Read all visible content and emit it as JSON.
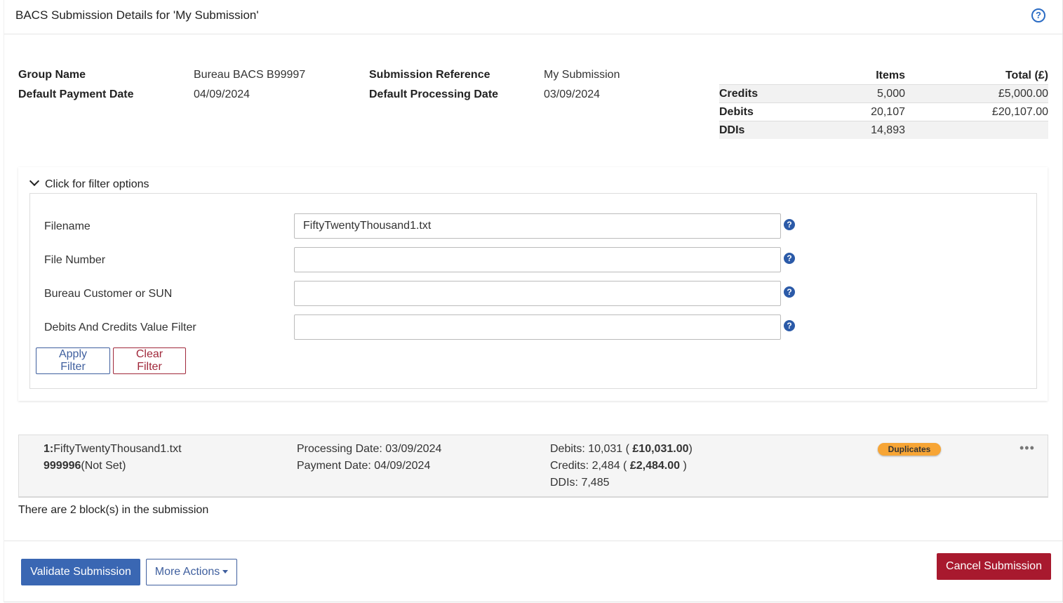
{
  "header": {
    "title": "BACS Submission Details for 'My Submission'",
    "help_icon": "?"
  },
  "details": {
    "group_name_label": "Group Name",
    "group_name_value": "Bureau BACS B99997",
    "default_payment_date_label": "Default Payment Date",
    "default_payment_date_value": "04/09/2024",
    "submission_reference_label": "Submission Reference",
    "submission_reference_value": "My Submission",
    "default_processing_date_label": "Default Processing Date",
    "default_processing_date_value": "03/09/2024"
  },
  "totals": {
    "headers": {
      "items": "Items",
      "total": "Total (£)"
    },
    "rows": [
      {
        "name": "Credits",
        "items": "5,000",
        "total": "£5,000.00"
      },
      {
        "name": "Debits",
        "items": "20,107",
        "total": "£20,107.00"
      },
      {
        "name": "DDIs",
        "items": "14,893",
        "total": ""
      }
    ]
  },
  "filter": {
    "toggle_label": "Click for filter options",
    "fields": [
      {
        "label": "Filename",
        "value": "FiftyTwentyThousand1.txt"
      },
      {
        "label": "File Number",
        "value": ""
      },
      {
        "label": "Bureau Customer or SUN",
        "value": ""
      },
      {
        "label": "Debits And Credits Value Filter",
        "value": ""
      }
    ],
    "help_icon": "?",
    "apply_label": "Apply Filter",
    "clear_label": "Clear Filter"
  },
  "block": {
    "index": "1:",
    "filename": "FiftyTwentyThousand1.txt",
    "sun": "999996",
    "sun_suffix": "(Not Set)",
    "processing_date": "Processing Date: 03/09/2024",
    "payment_date": "Payment Date: 04/09/2024",
    "debits_prefix": "Debits: 10,031 ( ",
    "debits_amount": "£10,031.00",
    "debits_suffix": ")",
    "credits_prefix": "Credits: 2,484 ( ",
    "credits_amount": "£2,484.00",
    "credits_suffix": " )",
    "ddis": "DDIs: 7,485",
    "badge": "Duplicates",
    "menu": "•••"
  },
  "blocks_count": "There are 2 block(s) in the submission",
  "footer": {
    "validate_label": "Validate Submission",
    "more_actions_label": "More Actions",
    "cancel_label": "Cancel Submission"
  },
  "colors": {
    "primary": "#3a67b3",
    "danger": "#a8192e",
    "badge": "#f7a535"
  }
}
